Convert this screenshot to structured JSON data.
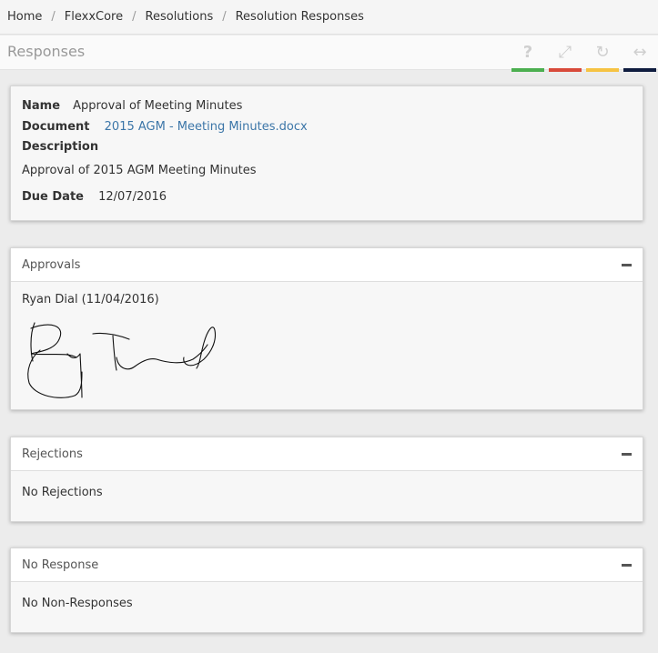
{
  "breadcrumb": [
    "Home",
    "FlexxCore",
    "Resolutions",
    "Resolution Responses"
  ],
  "header": {
    "title": "Responses",
    "tools": [
      {
        "icon": "help-icon",
        "glyph": "?",
        "color": "#4caf50"
      },
      {
        "icon": "fullscreen-icon",
        "glyph": "⤢",
        "color": "#e53935"
      },
      {
        "icon": "refresh-icon",
        "glyph": "↻",
        "color": "#fbc02d"
      },
      {
        "icon": "collapse-width-icon",
        "glyph": "↔",
        "color": "#0d1b3e"
      }
    ]
  },
  "details": {
    "name_label": "Name",
    "name_value": "Approval of Meeting Minutes",
    "document_label": "Document",
    "document_value": "2015 AGM - Meeting Minutes.docx",
    "description_label": "Description",
    "description_value": "Approval of 2015 AGM Meeting Minutes",
    "due_label": "Due Date",
    "due_value": "12/07/2016"
  },
  "approvals": {
    "title": "Approvals",
    "entry": "Ryan Dial (11/04/2016)"
  },
  "rejections": {
    "title": "Rejections",
    "empty": "No Rejections"
  },
  "no_response": {
    "title": "No Response",
    "empty": "No Non-Responses"
  }
}
